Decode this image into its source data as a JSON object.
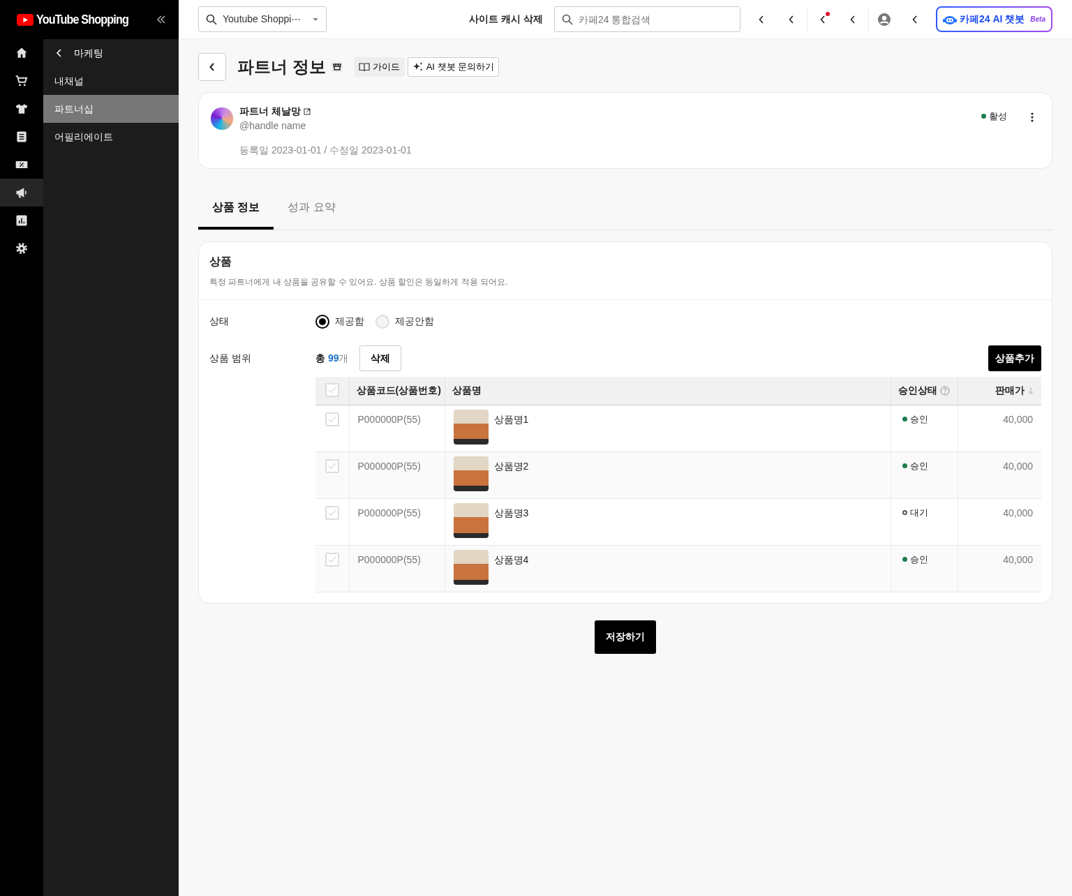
{
  "logo": {
    "text": "YouTube Shopping"
  },
  "rail_items": [
    {
      "selected": false
    },
    {
      "selected": false
    },
    {
      "selected": false
    },
    {
      "selected": false
    },
    {
      "selected": false
    },
    {
      "selected": true
    },
    {
      "selected": false
    },
    {
      "selected": false
    }
  ],
  "submenu": {
    "back_label": "마케팅",
    "items": [
      {
        "label": "내채널",
        "selected": false
      },
      {
        "label": "파트너십",
        "selected": true
      },
      {
        "label": "어필리에이트",
        "selected": false
      }
    ]
  },
  "topbar": {
    "shop_select": "Youtube Shoppi⋯",
    "cache_link": "사이트 캐시 삭제",
    "search_placeholder": "카페24 통합검색",
    "icons": [
      {
        "kind": "chevron",
        "dot": false
      },
      {
        "kind": "chevron",
        "dot": false
      },
      {
        "kind": "chevron",
        "dot": true
      },
      {
        "kind": "chevron",
        "dot": false
      },
      {
        "kind": "avatar",
        "dot": false
      },
      {
        "kind": "chevron",
        "dot": false
      }
    ],
    "chatbot": {
      "label": "카페24 AI 챗봇",
      "badge": "Beta"
    }
  },
  "page": {
    "title": "파트너 정보",
    "guide_button": "가이드",
    "ai_button": "AI 챗봇 문의하기"
  },
  "partner": {
    "name": "파트너 체날망",
    "handle": "@handle name",
    "dates": "등록일 2023-01-01 / 수정일 2023-01-01",
    "status": {
      "label": "활성",
      "color": "#1e7d4f"
    }
  },
  "tabs": [
    {
      "label": "상품 정보",
      "selected": true
    },
    {
      "label": "성과 요약",
      "selected": false
    }
  ],
  "products": {
    "title": "상품",
    "description": "특정 파트너에게 내 상품을 공유할 수 있어요. 상품 할인은 동일하게 적용 되어요.",
    "state_label": "상태",
    "options": [
      {
        "label": "제공함",
        "selected": true,
        "disabled": false
      },
      {
        "label": "제공안함",
        "selected": false,
        "disabled": true
      }
    ],
    "range_label": "상품 범위",
    "total_prefix": "총",
    "total_count": "99",
    "total_unit": "개",
    "delete_button": "삭제",
    "add_button": "상품추가",
    "table": {
      "header_checked": false,
      "columns": [
        "상품코드(상품번호)",
        "상품명",
        "승인상태",
        "판매가"
      ],
      "rows": [
        {
          "checked": false,
          "code": "P000000P(55)",
          "name": "상품명1",
          "status": "승인",
          "pending": false,
          "color": "#1e7d4f",
          "price": "40,000"
        },
        {
          "checked": false,
          "code": "P000000P(55)",
          "name": "상품명2",
          "status": "승인",
          "pending": false,
          "color": "#1e7d4f",
          "price": "40,000"
        },
        {
          "checked": false,
          "code": "P000000P(55)",
          "name": "상품명3",
          "status": "대기",
          "pending": true,
          "color": "#555555",
          "price": "40,000"
        },
        {
          "checked": false,
          "code": "P000000P(55)",
          "name": "상품명4",
          "status": "승인",
          "pending": false,
          "color": "#1e7d4f",
          "price": "40,000"
        }
      ]
    }
  },
  "save_button": "저장하기"
}
